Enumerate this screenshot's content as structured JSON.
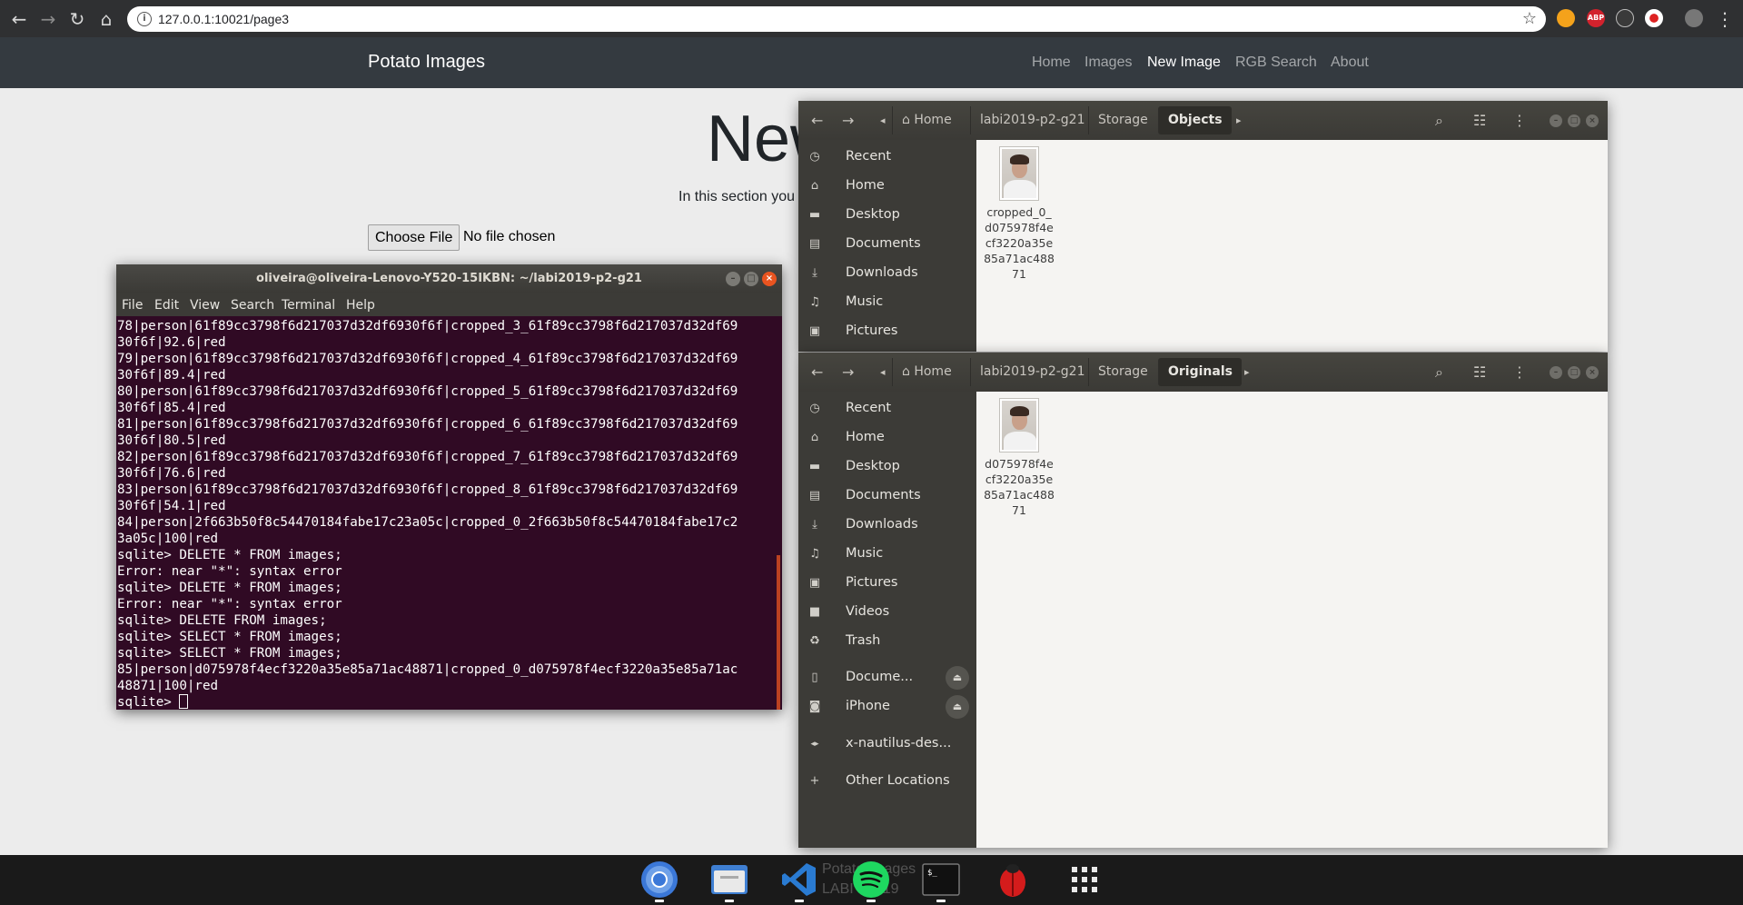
{
  "browser": {
    "url": "127.0.0.1:10021/page3",
    "extensions": [
      "extension-icon",
      "ABP",
      "hand-extension-icon",
      "record-extension-icon",
      "profile-avatar"
    ]
  },
  "site": {
    "brand": "Potato Images",
    "nav": [
      "Home",
      "Images",
      "New Image",
      "RGB Search",
      "About"
    ],
    "active_nav": "New Image",
    "heading": "New",
    "description": "In this section you",
    "file_button": "Choose File",
    "file_status": "No file chosen"
  },
  "terminal": {
    "title": "oliveira@oliveira-Lenovo-Y520-15IKBN: ~/labi2019-p2-g21",
    "menu": [
      "File",
      "Edit",
      "View",
      "Search",
      "Terminal",
      "Help"
    ],
    "lines": [
      "78|person|61f89cc3798f6d217037d32df6930f6f|cropped_3_61f89cc3798f6d217037d32df69",
      "30f6f|92.6|red",
      "79|person|61f89cc3798f6d217037d32df6930f6f|cropped_4_61f89cc3798f6d217037d32df69",
      "30f6f|89.4|red",
      "80|person|61f89cc3798f6d217037d32df6930f6f|cropped_5_61f89cc3798f6d217037d32df69",
      "30f6f|85.4|red",
      "81|person|61f89cc3798f6d217037d32df6930f6f|cropped_6_61f89cc3798f6d217037d32df69",
      "30f6f|80.5|red",
      "82|person|61f89cc3798f6d217037d32df6930f6f|cropped_7_61f89cc3798f6d217037d32df69",
      "30f6f|76.6|red",
      "83|person|61f89cc3798f6d217037d32df6930f6f|cropped_8_61f89cc3798f6d217037d32df69",
      "30f6f|54.1|red",
      "84|person|2f663b50f8c54470184fabe17c23a05c|cropped_0_2f663b50f8c54470184fabe17c2",
      "3a05c|100|red",
      "sqlite> DELETE * FROM images;",
      "Error: near \"*\": syntax error",
      "sqlite> DELETE * FROM images;",
      "Error: near \"*\": syntax error",
      "sqlite> DELETE FROM images;",
      "sqlite> SELECT * FROM images;",
      "sqlite> SELECT * FROM images;",
      "85|person|d075978f4ecf3220a35e85a71ac48871|cropped_0_d075978f4ecf3220a35e85a71ac",
      "48871|100|red"
    ],
    "prompt": "sqlite> "
  },
  "files_top": {
    "breadcrumbs": [
      "Home",
      "labi2019-p2-g21",
      "Storage",
      "Objects"
    ],
    "sidebar": [
      {
        "icon": "clock-icon",
        "glyph": "◷",
        "label": "Recent"
      },
      {
        "icon": "home-icon",
        "glyph": "⌂",
        "label": "Home"
      },
      {
        "icon": "desktop-icon",
        "glyph": "▬",
        "label": "Desktop"
      },
      {
        "icon": "document-icon",
        "glyph": "▤",
        "label": "Documents"
      },
      {
        "icon": "download-icon",
        "glyph": "⤓",
        "label": "Downloads"
      },
      {
        "icon": "music-icon",
        "glyph": "♫",
        "label": "Music"
      },
      {
        "icon": "picture-icon",
        "glyph": "▣",
        "label": "Pictures"
      }
    ],
    "file": {
      "name": "cropped_0_\nd075978f4e\ncf3220a35e\n85a71ac488\n71"
    }
  },
  "files_bottom": {
    "breadcrumbs": [
      "Home",
      "labi2019-p2-g21",
      "Storage",
      "Originals"
    ],
    "sidebar": [
      {
        "icon": "clock-icon",
        "glyph": "◷",
        "label": "Recent"
      },
      {
        "icon": "home-icon",
        "glyph": "⌂",
        "label": "Home"
      },
      {
        "icon": "desktop-icon",
        "glyph": "▬",
        "label": "Desktop"
      },
      {
        "icon": "document-icon",
        "glyph": "▤",
        "label": "Documents"
      },
      {
        "icon": "download-icon",
        "glyph": "⤓",
        "label": "Downloads"
      },
      {
        "icon": "music-icon",
        "glyph": "♫",
        "label": "Music"
      },
      {
        "icon": "picture-icon",
        "glyph": "▣",
        "label": "Pictures"
      },
      {
        "icon": "video-icon",
        "glyph": "■",
        "label": "Videos"
      },
      {
        "icon": "trash-icon",
        "glyph": "♻",
        "label": "Trash"
      },
      {
        "icon": "phone-icon",
        "glyph": "▯",
        "label": "Docume...",
        "eject": true
      },
      {
        "icon": "camera-icon",
        "glyph": "◙",
        "label": "iPhone",
        "eject": true
      },
      {
        "icon": "network-icon",
        "glyph": "◂▸",
        "label": "x-nautilus-des..."
      },
      {
        "icon": "plus-icon",
        "glyph": "+",
        "label": "Other Locations"
      }
    ],
    "file": {
      "name": "d075978f4e\ncf3220a35e\n85a71ac488\n71"
    }
  },
  "dock": {
    "apps": [
      "chrome-icon",
      "files-icon",
      "vscode-icon",
      "spotify-icon",
      "terminal-icon",
      "bug-icon",
      "app-grid-icon"
    ],
    "ghost_text": "Potato Images\nLABI - 2019"
  },
  "colors": {
    "navbar": "#343a40",
    "terminal_bg": "#300a24",
    "ubuntu_orange": "#e95420",
    "nautilus_bg": "#3c3b37"
  }
}
